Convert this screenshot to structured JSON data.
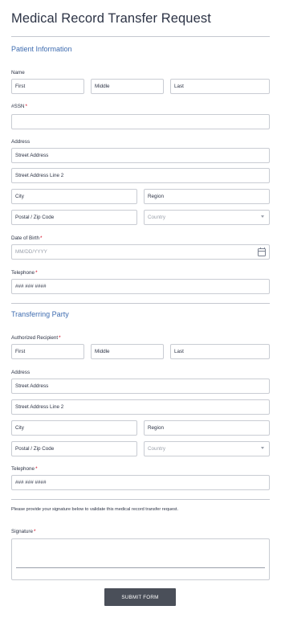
{
  "form": {
    "title": "Medical Record Transfer Request",
    "patient_section": {
      "heading": "Patient Information",
      "name_label": "Name",
      "first_placeholder": "First",
      "middle_placeholder": "Middle",
      "last_placeholder": "Last",
      "ssn_label": "#SSN",
      "ssn_value": "",
      "address_label": "Address",
      "street_placeholder": "Street Address",
      "street2_placeholder": "Street Address Line 2",
      "city_placeholder": "City",
      "region_placeholder": "Region",
      "postal_placeholder": "Postal / Zip Code",
      "country_placeholder": "Country",
      "dob_label": "Date of Birth",
      "dob_placeholder": "MM/DD/YYYY",
      "telephone_label": "Telephone",
      "telephone_placeholder": "### ### ####"
    },
    "transfer_section": {
      "heading": "Transferring Party",
      "recipient_label": "Authorized Recipient",
      "first_placeholder": "First",
      "middle_placeholder": "Middle",
      "last_placeholder": "Last",
      "address_label": "Address",
      "street_placeholder": "Street Address",
      "street2_placeholder": "Street Address Line 2",
      "city_placeholder": "City",
      "region_placeholder": "Region",
      "postal_placeholder": "Postal / Zip Code",
      "country_placeholder": "Country",
      "telephone_label": "Telephone",
      "telephone_placeholder": "### ### ####"
    },
    "signature_note": "Please provide your signature below to validate this medical record transfer request.",
    "signature_label": "Signature",
    "required_mark": "*",
    "submit_label": "SUBMIT FORM"
  },
  "colors": {
    "section_heading": "#3e6cb0",
    "required": "#d0021b",
    "submit_bg": "#4a4f59"
  },
  "icons": {
    "calendar": "calendar-icon",
    "dropdown": "chevron-down-icon"
  }
}
